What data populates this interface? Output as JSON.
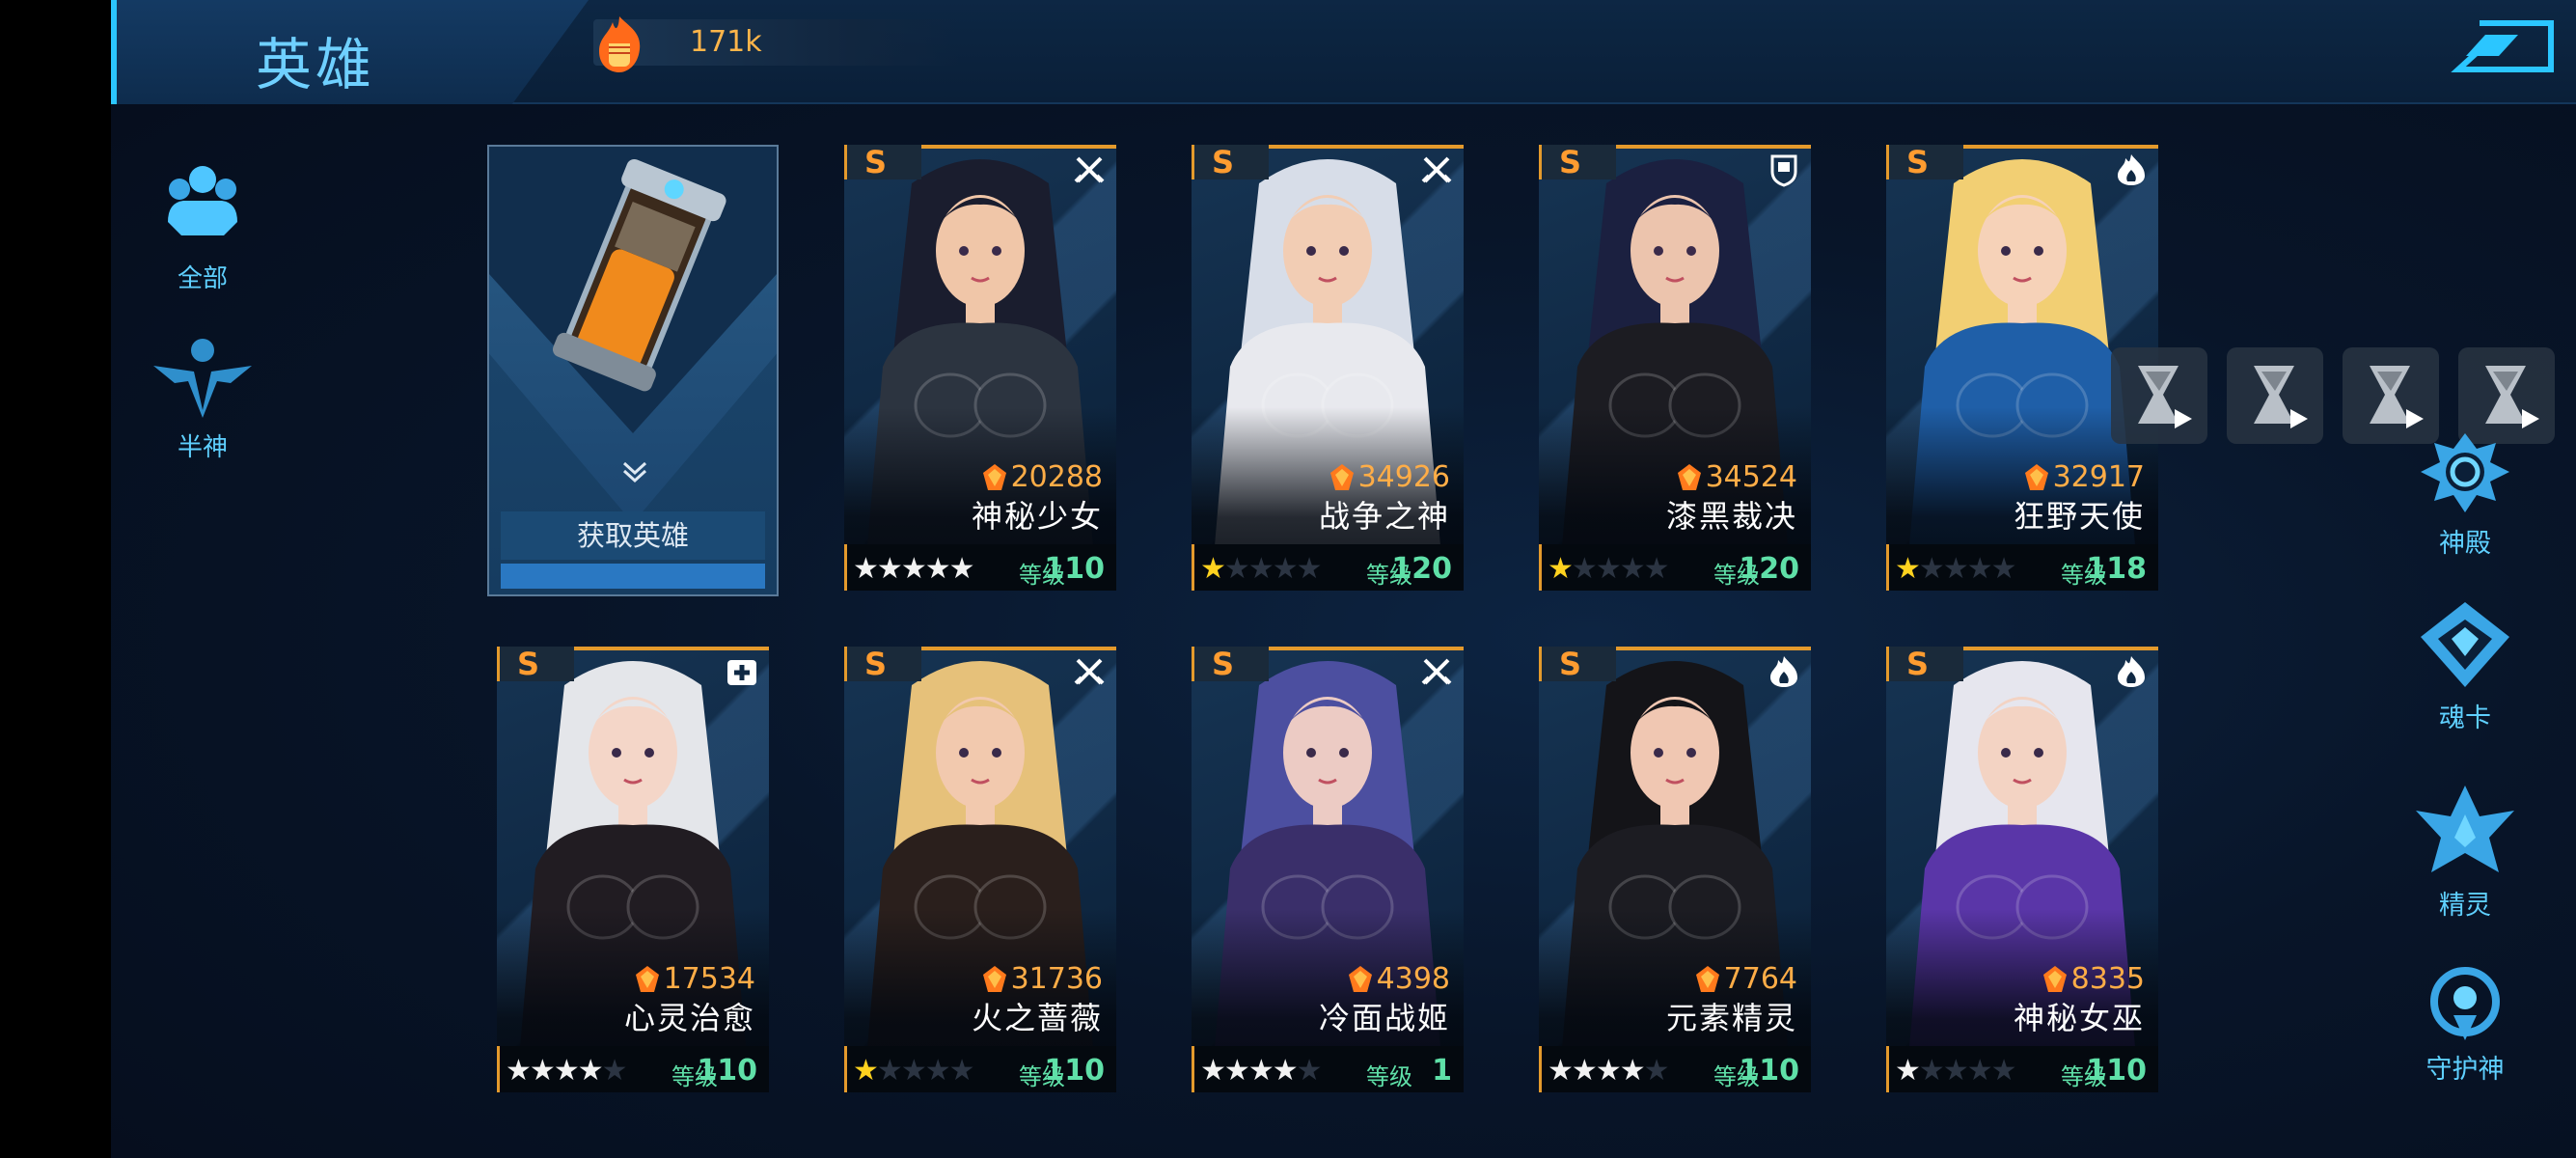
{
  "header": {
    "title": "英雄",
    "currency_value": "171k",
    "currency_icon": "fist-flame-icon",
    "back_icon": "back-arrow-icon"
  },
  "left_nav": [
    {
      "label": "全部",
      "icon": "group-icon",
      "selected": true
    },
    {
      "label": "半神",
      "icon": "winged-figure-icon",
      "selected": false
    }
  ],
  "right_nav": [
    {
      "label": "神殿",
      "icon": "temple-icon"
    },
    {
      "label": "魂卡",
      "icon": "soulcard-icon"
    },
    {
      "label": "精灵",
      "icon": "spirit-icon"
    },
    {
      "label": "守护神",
      "icon": "guardian-icon"
    }
  ],
  "acquire_card": {
    "label": "获取英雄",
    "icon": "capsule-icon"
  },
  "slots": [
    {
      "icon": "hourglass-icon",
      "badge": "play-icon"
    },
    {
      "icon": "hourglass-icon",
      "badge": "play-icon"
    },
    {
      "icon": "hourglass-icon",
      "badge": "play-icon"
    },
    {
      "icon": "hourglass-icon",
      "badge": "play-icon"
    }
  ],
  "level_label": "等级",
  "heroes": [
    {
      "rank": "S",
      "role": "swords-icon",
      "power": "20288",
      "name": "神秘少女",
      "stars": 5,
      "star_color": "white",
      "level": "110",
      "hair": "#1a1d2e",
      "suit": "#2c3440",
      "skin": "#f0c6a8"
    },
    {
      "rank": "S",
      "role": "swords-icon",
      "power": "34926",
      "name": "战争之神",
      "stars": 1,
      "star_color": "gold",
      "level": "120",
      "hair": "#d7dde8",
      "suit": "#e8e9ee",
      "skin": "#f2cdb4"
    },
    {
      "rank": "S",
      "role": "shield-icon",
      "power": "34524",
      "name": "漆黑裁决",
      "stars": 1,
      "star_color": "gold",
      "level": "120",
      "hair": "#1b2040",
      "suit": "#1c1c22",
      "skin": "#ecc4ad"
    },
    {
      "rank": "S",
      "role": "flame-icon",
      "power": "32917",
      "name": "狂野天使",
      "stars": 1,
      "star_color": "gold",
      "level": "118",
      "hair": "#f2cf73",
      "suit": "#1f5fa8",
      "skin": "#f6d2b8"
    },
    {
      "rank": "S",
      "role": "medkit-icon",
      "power": "17534",
      "name": "心灵治愈",
      "stars": 4,
      "star_color": "white",
      "level": "110",
      "hair": "#e4e6ea",
      "suit": "#211c22",
      "skin": "#f4d6c8"
    },
    {
      "rank": "S",
      "role": "swords-icon",
      "power": "31736",
      "name": "火之蔷薇",
      "stars": 1,
      "star_color": "gold",
      "level": "110",
      "hair": "#e6c17a",
      "suit": "#2a1f1c",
      "skin": "#f2c9ae"
    },
    {
      "rank": "S",
      "role": "swords-icon",
      "power": "4398",
      "name": "冷面战姬",
      "stars": 4,
      "star_color": "white",
      "level": "1",
      "hair": "#4c4fa0",
      "suit": "#3a2f6a",
      "skin": "#eccbc4"
    },
    {
      "rank": "S",
      "role": "flame-icon",
      "power": "7764",
      "name": "元素精灵",
      "stars": 4,
      "star_color": "white",
      "level": "110",
      "hair": "#141418",
      "suit": "#1c1c22",
      "skin": "#f0c7b2"
    },
    {
      "rank": "S",
      "role": "flame-icon",
      "power": "8335",
      "name": "神秘女巫",
      "stars": 1,
      "star_color": "white",
      "level": "110",
      "hair": "#e6e6ee",
      "suit": "#5a36a8",
      "skin": "#f3d3c3"
    }
  ]
}
